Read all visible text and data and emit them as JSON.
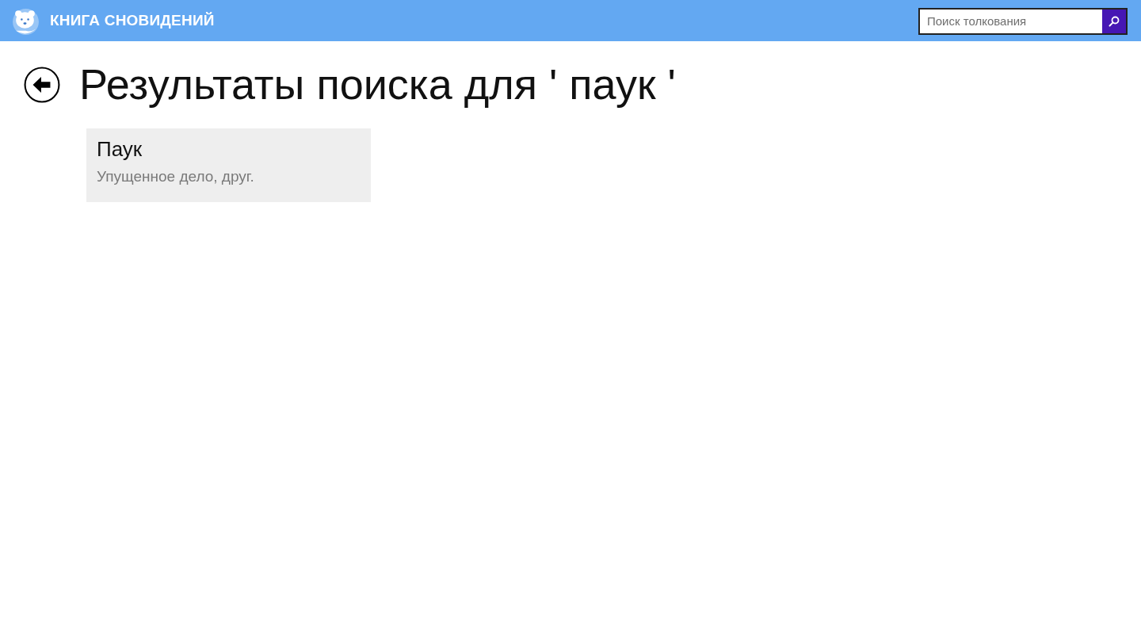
{
  "header": {
    "app_title": "КНИГА СНОВИДЕНИЙ",
    "search": {
      "placeholder": "Поиск толкования"
    }
  },
  "page": {
    "title": "Результаты поиска для ' паук '"
  },
  "results": [
    {
      "title": "Паук",
      "description": "Упущенное дело, друг."
    }
  ]
}
